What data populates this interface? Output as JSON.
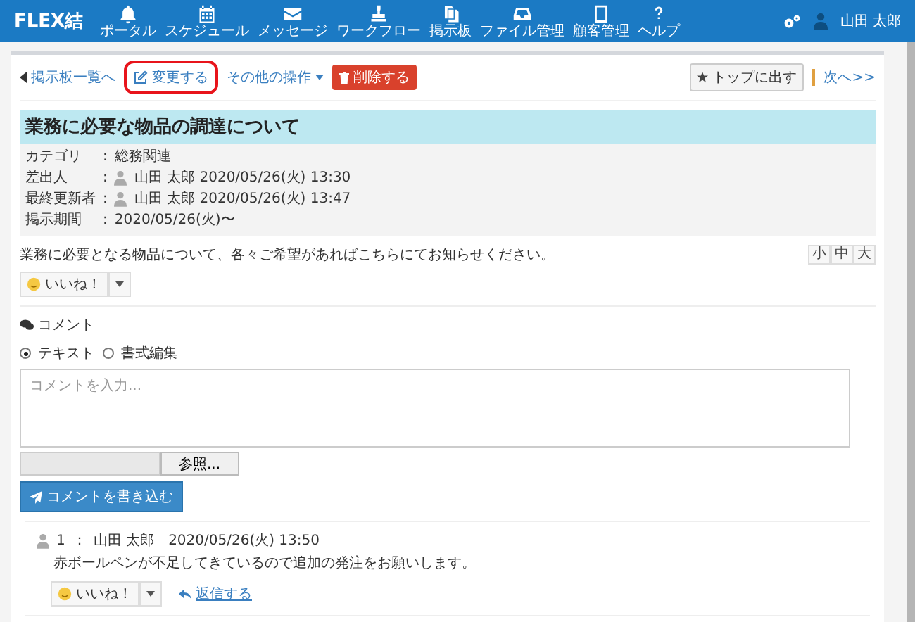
{
  "header": {
    "logo": "FLEX結",
    "nav": [
      {
        "label": "ポータル"
      },
      {
        "label": "スケジュール"
      },
      {
        "label": "メッセージ"
      },
      {
        "label": "ワークフロー"
      },
      {
        "label": "掲示板"
      },
      {
        "label": "ファイル管理"
      },
      {
        "label": "顧客管理"
      },
      {
        "label": "ヘルプ"
      }
    ],
    "user": "山田 太郎"
  },
  "toolbar": {
    "back": "掲示板一覧へ",
    "edit": {
      "label": "変更する",
      "highlighted": true
    },
    "more": "その他の操作",
    "delete": "削除する",
    "pin": "トップに出す",
    "next": "次へ>>"
  },
  "post": {
    "title": "業務に必要な物品の調達について",
    "meta": [
      {
        "label": "カテゴリ",
        "colon": ":",
        "value": "総務関連",
        "user": false
      },
      {
        "label": "差出人",
        "colon": ":",
        "value": "山田 太郎 2020/05/26(火) 13:30",
        "user": true
      },
      {
        "label": "最終更新者",
        "colon": ":",
        "value": "山田 太郎 2020/05/26(火) 13:47",
        "user": true
      },
      {
        "label": "掲示期間",
        "colon": ":",
        "value": "2020/05/26(火)〜",
        "user": false
      }
    ],
    "body": "業務に必要となる物品について、各々ご希望があればこちらにてお知らせください。",
    "font_sizes": [
      "小",
      "中",
      "大"
    ],
    "like": "いいね！"
  },
  "comment_form": {
    "heading": "コメント",
    "modes": [
      {
        "label": "テキスト",
        "selected": true
      },
      {
        "label": "書式編集",
        "selected": false
      }
    ],
    "placeholder": "コメントを入力...",
    "browse": "参照...",
    "submit": "コメントを書き込む"
  },
  "comments": [
    {
      "number": "1",
      "sep": "：",
      "author": "山田 太郎",
      "time": "2020/05/26(火) 13:50",
      "text": "赤ボールペンが不足してきているので追加の発注をお願いします。",
      "like": "いいね！",
      "reply": "返信する"
    }
  ]
}
